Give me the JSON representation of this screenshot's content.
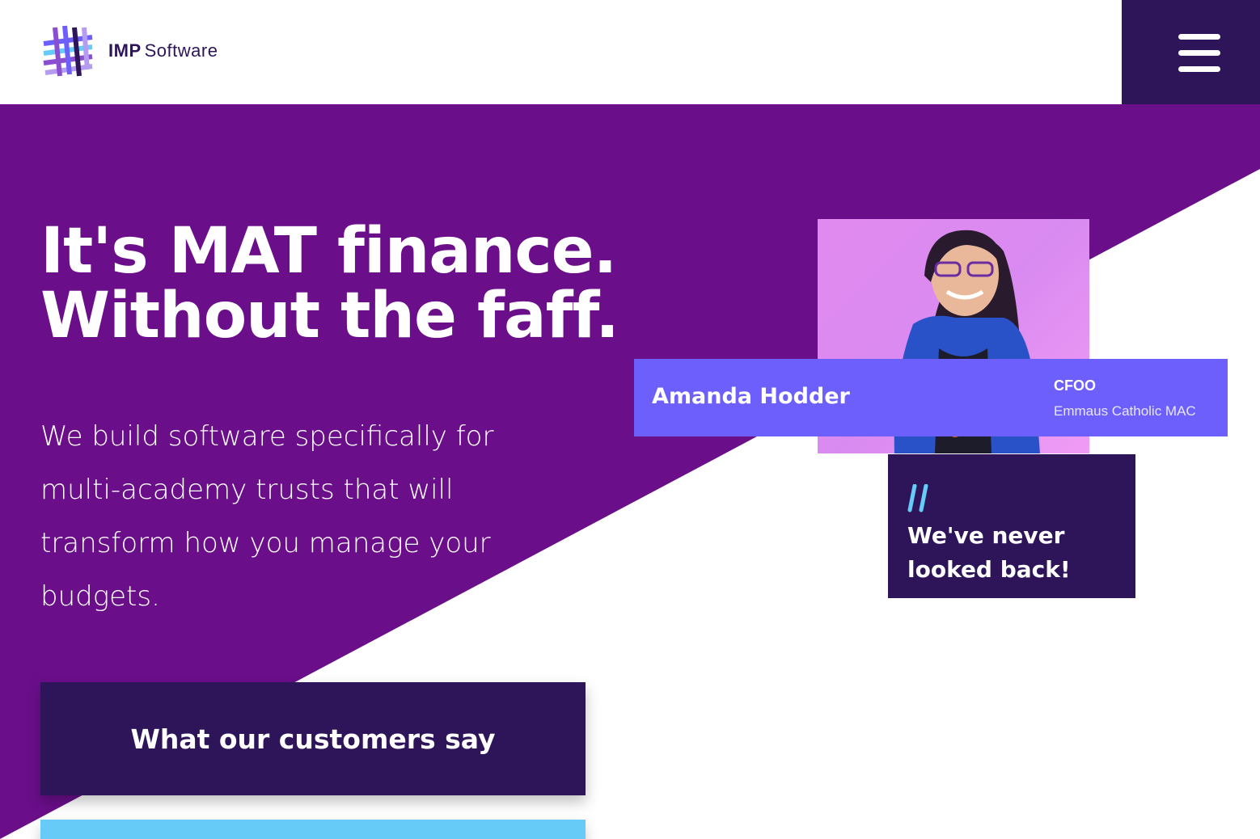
{
  "brand": {
    "name_bold": "IMP",
    "name_light": "Software"
  },
  "header": {
    "menu_icon": "hamburger-menu-icon"
  },
  "hero": {
    "headline_line1": "It's MAT finance.",
    "headline_line2": "Without the faff.",
    "subtext": "We build software specifically for multi-academy trusts that will transform how you manage your budgets.",
    "cta_primary_label": "What our customers say",
    "cta_secondary_label": ""
  },
  "testimonial": {
    "name": "Amanda Hodder",
    "role": "CFOO",
    "organization": "Emmaus Catholic MAC",
    "quote": "We've never looked back!"
  },
  "colors": {
    "purple_primary": "#6a0e8a",
    "purple_dark": "#2e1559",
    "violet_accent": "#6c5ffc",
    "cyan_accent": "#66ccf7",
    "photo_background": "#e18aef"
  }
}
